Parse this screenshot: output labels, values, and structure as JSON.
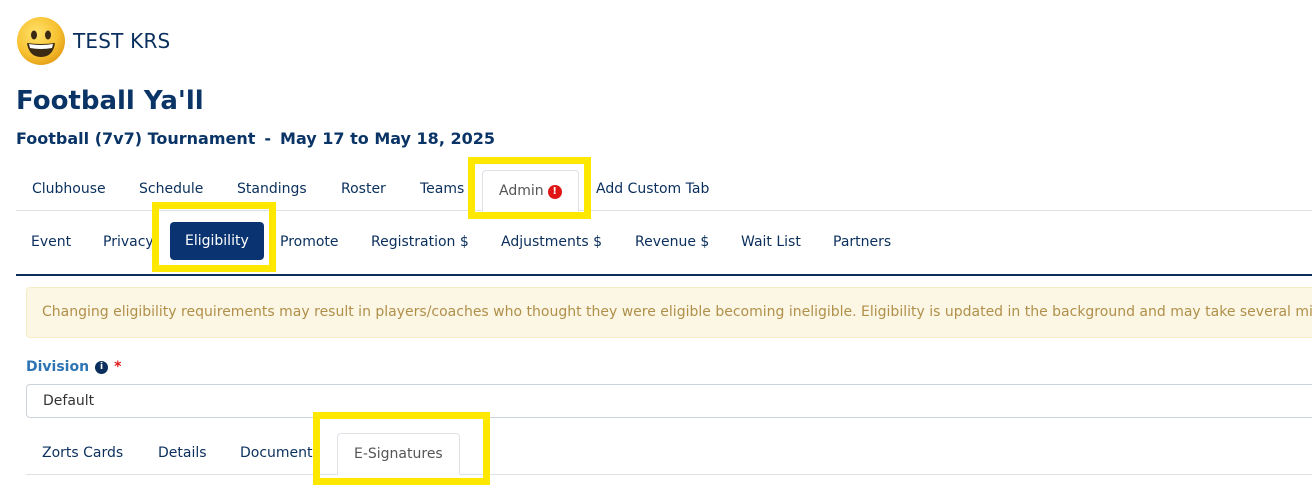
{
  "org": {
    "name": "TEST KRS",
    "avatar_icon": "grinning-face-icon"
  },
  "event": {
    "title": "Football Ya'll",
    "sport": "Football (7v7) Tournament",
    "separator": "-",
    "dates": "May 17 to May 18, 2025"
  },
  "main_tabs": [
    {
      "label": "Clubhouse"
    },
    {
      "label": "Schedule"
    },
    {
      "label": "Standings"
    },
    {
      "label": "Roster"
    },
    {
      "label": "Teams"
    },
    {
      "label": "Admin",
      "active": true,
      "badge_icon": "exclamation-circle-icon",
      "badge_glyph": "!"
    },
    {
      "label": "Add Custom Tab"
    }
  ],
  "admin_tabs": [
    {
      "label": "Event"
    },
    {
      "label": "Privacy"
    },
    {
      "label": "Eligibility",
      "active": true
    },
    {
      "label": "Promote"
    },
    {
      "label": "Registration $"
    },
    {
      "label": "Adjustments $"
    },
    {
      "label": "Revenue $"
    },
    {
      "label": "Wait List"
    },
    {
      "label": "Partners"
    }
  ],
  "warning": {
    "text": "Changing eligibility requirements may result in players/coaches who thought they were eligible becoming ineligible. Eligibility is updated in the background and may take several minutes."
  },
  "division": {
    "label": "Division",
    "info_glyph": "i",
    "required_mark": "*",
    "selected": "Default"
  },
  "division_tabs": [
    {
      "label": "Zorts Cards"
    },
    {
      "label": "Details"
    },
    {
      "label": "Documents"
    },
    {
      "label": "E-Signatures",
      "active": true
    }
  ],
  "colors": {
    "primary": "#0a2f5c",
    "active_pill": "#0a3471",
    "highlight": "#ffe800",
    "alert": "#e01616",
    "warning_bg": "#fcf7e4",
    "warning_text": "#b08f4a",
    "label_blue": "#2d74b4"
  }
}
